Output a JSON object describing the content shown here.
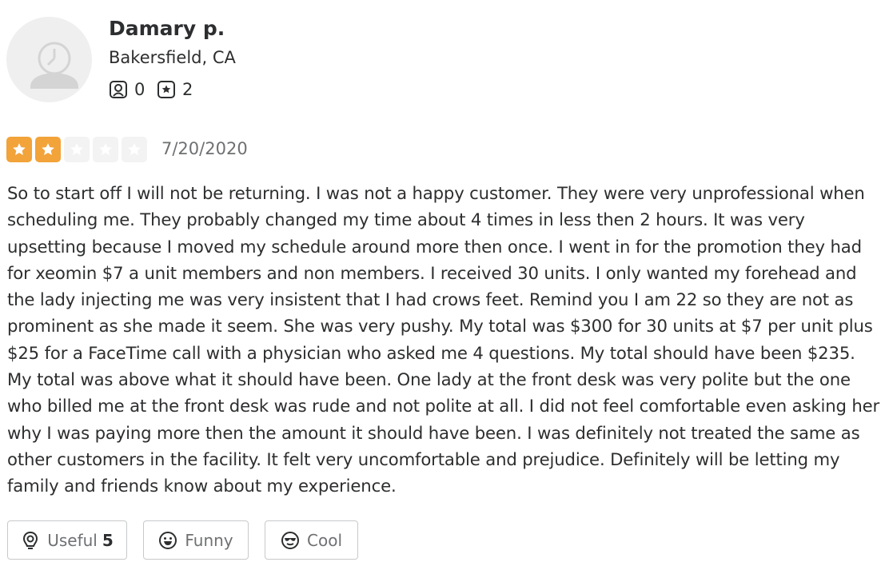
{
  "user": {
    "name": "Damary p.",
    "location": "Bakersfield, CA",
    "friend_count": "0",
    "review_count": "2",
    "friends_icon": "friends-icon",
    "reviews_icon": "star-review-icon"
  },
  "review": {
    "rating": 2,
    "max_rating": 5,
    "star_color": "#f2a33a",
    "date": "7/20/2020",
    "text": "So to start off I will not be returning. I was not a happy customer. They were very unprofessional when scheduling me. They probably changed my time about 4 times in less then 2 hours. It was very upsetting because I moved my schedule around more then once. I went in for the promotion they had for xeomin $7 a unit  members and non members. I received 30 units. I only wanted my forehead and the lady injecting me was very insistent that I had crows feet. Remind you I am 22 so they are not as prominent as she made it seem. She was very pushy. My total was $300 for 30 units at $7 per unit plus $25 for a FaceTime call with a physician who asked me 4 questions. My total should have been $235. My total was above what it should have been. One lady at the front desk was very polite but the one who billed me at the front desk was rude and not polite at all. I did not feel comfortable even asking her why I was paying more then the amount it should have been. I was definitely not treated the same as other customers in the facility. It felt very uncomfortable and prejudice. Definitely will be letting my family and friends know about my experience."
  },
  "actions": {
    "useful_label": "Useful",
    "useful_count": "5",
    "funny_label": "Funny",
    "cool_label": "Cool"
  }
}
